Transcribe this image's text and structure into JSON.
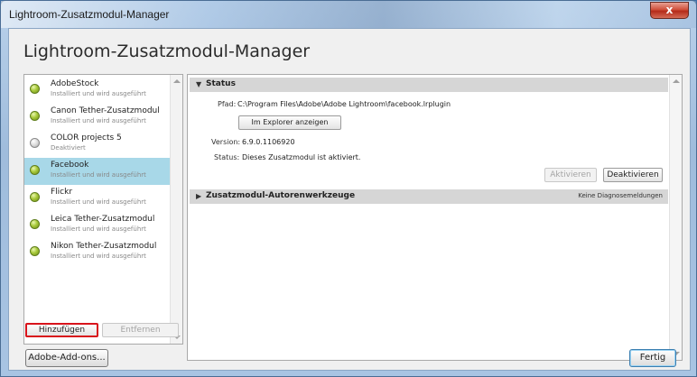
{
  "window": {
    "title": "Lightroom-Zusatzmodul-Manager",
    "close_glyph": "x"
  },
  "heading": "Lightroom-Zusatzmodul-Manager",
  "plugins": [
    {
      "name": "AdobeStock",
      "status": "Installiert und wird ausgeführt",
      "enabled": true
    },
    {
      "name": "Canon Tether-Zusatzmodul",
      "status": "Installiert und wird ausgeführt",
      "enabled": true
    },
    {
      "name": "COLOR projects 5",
      "status": "Deaktiviert",
      "enabled": false
    },
    {
      "name": "Facebook",
      "status": "Installiert und wird ausgeführt",
      "enabled": true,
      "selected": true
    },
    {
      "name": "Flickr",
      "status": "Installiert und wird ausgeführt",
      "enabled": true
    },
    {
      "name": "Leica Tether-Zusatzmodul",
      "status": "Installiert und wird ausgeführt",
      "enabled": true
    },
    {
      "name": "Nikon Tether-Zusatzmodul",
      "status": "Installiert und wird ausgeführt",
      "enabled": true
    }
  ],
  "list_buttons": {
    "add": "Hinzufügen",
    "remove": "Entfernen"
  },
  "status_section": {
    "title": "Status",
    "path_label": "Pfad:",
    "path_value": "C:\\Program Files\\Adobe\\Adobe Lightroom\\facebook.lrplugin",
    "explorer_button": "Im Explorer anzeigen",
    "version_label": "Version:",
    "version_value": "6.9.0.1106920",
    "status_label": "Status:",
    "status_value": "Dieses Zusatzmodul ist aktiviert.",
    "activate_button": "Aktivieren",
    "deactivate_button": "Deaktivieren"
  },
  "tools_section": {
    "title": "Zusatzmodul-Autorenwerkzeuge",
    "note": "Keine Diagnosemeldungen"
  },
  "footer": {
    "addons_button": "Adobe-Add-ons...",
    "done_button": "Fertig"
  },
  "colors": {
    "selected_row": "#a8d8e8",
    "highlight_border": "#d8131b",
    "enabled_dot": "#a8c93a"
  }
}
